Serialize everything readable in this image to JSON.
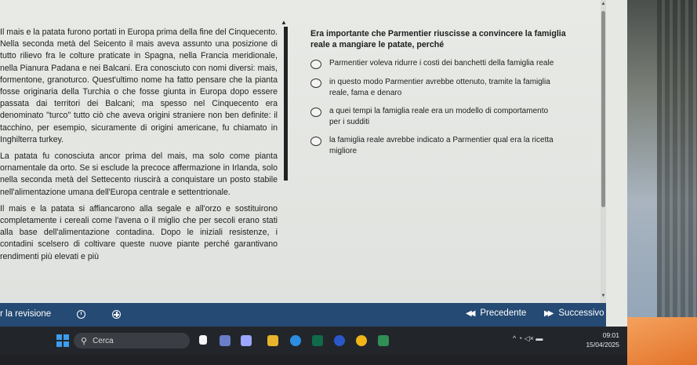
{
  "passage": {
    "paragraphs": [
      "Il mais e la patata furono portati in Europa prima della fine del Cinquecento. Nella seconda metà del Seicento il mais aveva assunto una posizione di tutto rilievo fra le colture praticate in Spagna, nella Francia meridionale, nella Pianura Padana e nei Balcani. Era conosciuto con nomi diversi: mais, formentone, granoturco. Quest'ultimo nome ha fatto pensare che la pianta fosse originaria della Turchia o che fosse giunta in Europa dopo essere passata dai territori dei Balcani; ma spesso nel Cinquecento era denominato \"turco\" tutto ciò che aveva origini straniere non ben definite: il tacchino, per esempio, sicuramente di origini americane, fu chiamato in Inghilterra turkey.",
      "La patata fu conosciuta ancor prima del mais, ma solo come pianta ornamentale da orto. Se si esclude la precoce affermazione in Irlanda, solo nella seconda metà del Settecento riuscirà a conquistare un posto stabile nell'alimentazione umana dell'Europa centrale e settentrionale.",
      "Il mais e la patata si affiancarono alla segale e all'orzo e sostituirono completamente i cereali come l'avena o il miglio che per secoli erano stati alla base dell'alimentazione contadina. Dopo le iniziali resistenze, i contadini scelsero di coltivare queste nuove piante perché garantivano rendimenti più elevati e più"
    ]
  },
  "question": {
    "text": "Era importante che Parmentier riuscisse a convincere la famiglia reale a mangiare le patate, perché",
    "options": [
      "Parmentier voleva ridurre i costi dei banchetti della famiglia reale",
      "in questo modo Parmentier avrebbe ottenuto, tramite la famiglia reale, fama e denaro",
      "a quei tempi la famiglia reale era un modello di comportamento per i sudditi",
      "la famiglia reale avrebbe indicato a Parmentier qual era la ricetta migliore"
    ]
  },
  "navbar": {
    "title": "r la revisione",
    "prev_label": "Precedente",
    "next_label": "Successivo",
    "prev_glyph": "◀◀",
    "next_glyph": "▶▶",
    "color": "#254a73"
  },
  "taskbar": {
    "search_placeholder": "Cerca",
    "search_icon": "search-icon",
    "time": "09:01",
    "date": "15/04/2025",
    "tray_glyphs": "^  ◔  ◁×  ▬"
  }
}
